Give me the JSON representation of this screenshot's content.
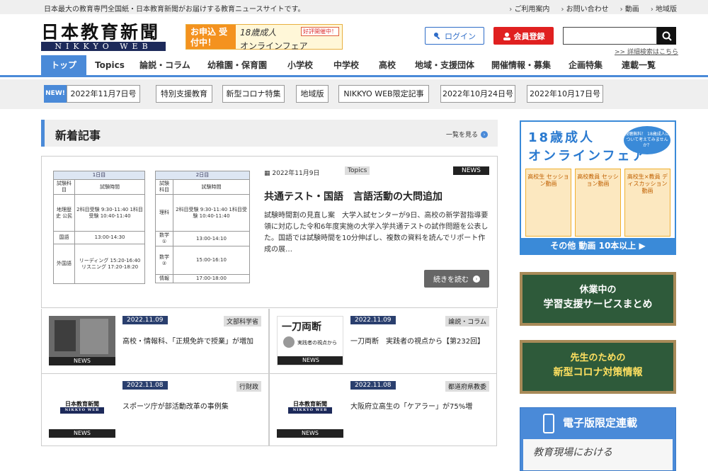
{
  "topbar": {
    "tagline": "日本最大の教育専門全国紙・日本教育新聞がお届けする教育ニュースサイトです。",
    "links": [
      "ご利用案内",
      "お問い合わせ",
      "動画",
      "地域版"
    ]
  },
  "logo": {
    "jp": "日本教育新聞",
    "en": "NIKKYO WEB"
  },
  "banner": {
    "left": "お申込 受付中！",
    "title": "18歳成人",
    "badge": "好評開催中！",
    "sub": "オンラインフェア"
  },
  "header": {
    "login": "ログイン",
    "register": "会員登録",
    "search_placeholder": "",
    "advanced": ">> 詳細検索はこちら"
  },
  "nav": [
    "トップ",
    "Topics",
    "論説・コラム",
    "幼稚園・保育園",
    "小学校",
    "中学校",
    "高校",
    "地域・支援団体",
    "開催情報・募集",
    "企画特集",
    "連載一覧"
  ],
  "tags": {
    "new": "NEW!",
    "items": [
      "2022年11月7日号",
      "特別支援教育",
      "新型コロナ特集",
      "地域版",
      "NIKKYO WEB限定記事",
      "2022年10月24日号",
      "2022年10月17日号"
    ]
  },
  "section": {
    "title": "新着記事",
    "more": "一覧を見る"
  },
  "feature": {
    "date": "2022年11月9日",
    "category": "Topics",
    "badge": "NEWS",
    "title": "共通テスト・国語　言語活動の大問追加",
    "body": "試験時間割の見直し案　大学入試センターが9日、高校の新学習指導要領に対応した令和6年度実施の大学入学共通テストの試作問題を公表した。国語では試験時間を10分伸ばし、複数の資料を読んでリポート作成の展…",
    "readmore": "続きを読む",
    "table1": {
      "title": "1日目",
      "head": [
        "試験科目",
        "試験時間"
      ],
      "rows": [
        [
          "地理歴史 公民",
          "2科目受験 9:30-11:40 1科目受験 10:40-11:40"
        ],
        [
          "国語",
          "13:00-14:30"
        ],
        [
          "外国語",
          "リーディング 15:20-16:40 リスニング 17:20-18:20"
        ]
      ]
    },
    "table2": {
      "title": "2日目",
      "head": [
        "試験科目",
        "試験時間"
      ],
      "rows": [
        [
          "理科",
          "2科目受験 9:30-11:40 1科目受験 10:40-11:40"
        ],
        [
          "数学①",
          "13:00-14:10"
        ],
        [
          "数学②",
          "15:00-16:10"
        ],
        [
          "情報",
          "17:00-18:00"
        ]
      ]
    }
  },
  "cards": [
    {
      "date": "2022.11.09",
      "cat": "文部科学省",
      "title": "高校・情報科、「正規免許で授業」が増加",
      "badge": "NEWS"
    },
    {
      "date": "2022.11.09",
      "cat": "論説・コラム",
      "title": "一刀両断　実践者の視点から【第232回】",
      "badge": "NEWS",
      "thumb_title": "一刀両断",
      "thumb_sub": "実践者の視点から"
    },
    {
      "date": "2022.11.08",
      "cat": "行財政",
      "title": "スポーツ庁が部活動改革の事例集",
      "badge": "NEWS"
    },
    {
      "date": "2022.11.08",
      "cat": "都道府県教委",
      "title": "大阪府立高生の「ケアラー」が75%増",
      "badge": "NEWS"
    }
  ],
  "side": {
    "fair_title1": "18歳成人",
    "fair_title2": "オンラインフェア",
    "fair_bubble": "視聴無料！ 18歳成人について考えてみませんか？",
    "fair_cols": [
      "高校生 セッション動画",
      "高校教員 セッション動画",
      "高校生×教員 ディスカッション動画"
    ],
    "fair_foot": "その他 動画 10本以上",
    "board1_a": "休業中の",
    "board1_b": "学習支援サービスまとめ",
    "board2_a": "先生のための",
    "board2_b": "新型コロナ対策情報",
    "digital": "電子版限定連載",
    "digital_note": "教育現場における"
  }
}
